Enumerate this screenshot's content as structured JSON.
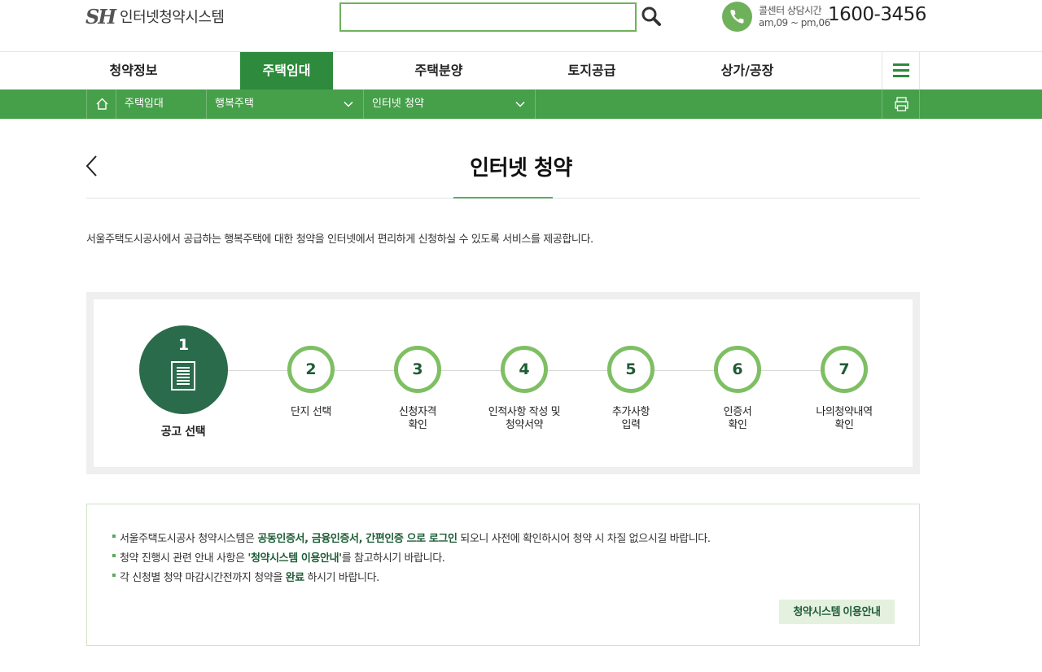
{
  "header": {
    "logo_mark": "SH",
    "logo_text": "인터넷청약시스템",
    "search_placeholder": "",
    "call_label_line1": "콜센터 상담시간",
    "call_label_line2": "am,09 ~ pm,06",
    "call_number": "1600-3456"
  },
  "mainnav": {
    "items": [
      {
        "label": "청약정보"
      },
      {
        "label": "주택임대",
        "active": true
      },
      {
        "label": "주택분양"
      },
      {
        "label": "토지공급"
      },
      {
        "label": "상가/공장"
      }
    ]
  },
  "subnav": {
    "crumb1": "주택임대",
    "crumb2": "행복주택",
    "crumb3": "인터넷 청약"
  },
  "page": {
    "title": "인터넷 청약",
    "intro": "서울주택도시공사에서 공급하는 행복주택에 대한 청약을 인터넷에서 편리하게 신청하실 수 있도록 서비스를 제공합니다."
  },
  "steps": [
    {
      "num": "1",
      "label": "공고 선택",
      "current": true
    },
    {
      "num": "2",
      "label": "단지 선택"
    },
    {
      "num": "3",
      "label": "신청자격\n확인"
    },
    {
      "num": "4",
      "label": "인적사항 작성 및\n청약서약"
    },
    {
      "num": "5",
      "label": "추가사항\n입력"
    },
    {
      "num": "6",
      "label": "인증서\n확인"
    },
    {
      "num": "7",
      "label": "나의청약내역\n확인"
    }
  ],
  "notice": {
    "line1_a": "서울주택도시공사 청약시스템은 ",
    "line1_b": "공동인증서, 금융인증서, 간편인증 으로 로그인",
    "line1_c": " 되오니 사전에 확인하시어 청약 시 차질 없으시길 바랍니다.",
    "line2_a": "청약 진행시 관련 안내 사항은 ",
    "line2_b": "'청약시스템 이용안내'",
    "line2_c": "를 참고하시기 바랍니다.",
    "line3_a": "각 신청별 청약 마감시간전까지 청약을 ",
    "line3_b": "완료",
    "line3_c": " 하시기 바랍니다.",
    "guide_button": "청약시스템 이용안내"
  },
  "colors": {
    "brand_green": "#46a04a",
    "active_green": "#2e8a3c",
    "step_dark": "#2a6b4b",
    "step_ring": "#7fbf64"
  }
}
